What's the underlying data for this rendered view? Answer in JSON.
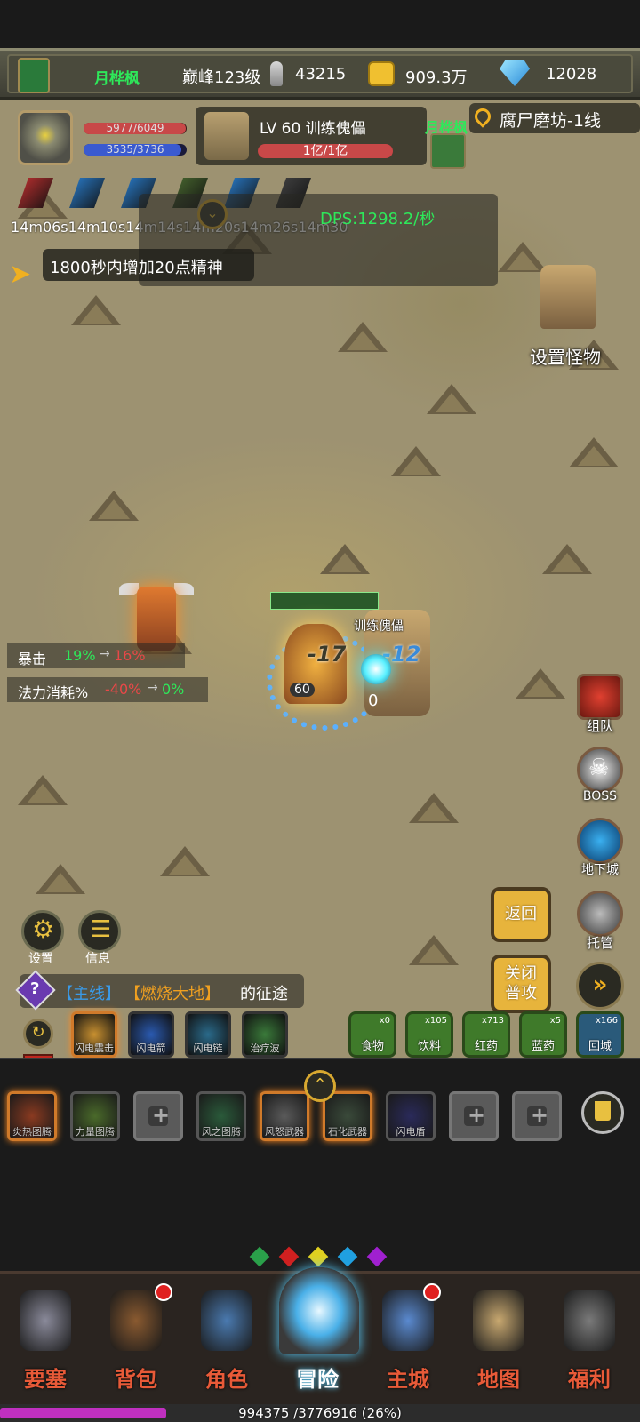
{
  "topbar": {
    "player_name": "月桦枫",
    "peak_level": "巅峰123级",
    "power": "43215",
    "gold": "909.3万",
    "diamonds": "12028"
  },
  "location": "腐尸磨坊-1线",
  "player": {
    "hp_text": "5977/6049",
    "hp_fraction": 0.988,
    "mp_text": "3535/3736",
    "mp_fraction": 0.946
  },
  "target": {
    "title": "LV 60 训练傀儡",
    "hp_text": "1亿/1亿",
    "hp_fraction": 1.0
  },
  "teammate_name": "月桦枫",
  "buffs": {
    "timers": "14m06s14m10s14m14s14m20s14m26s14m30s",
    "colors": [
      "#c23030",
      "#2a7fd0",
      "#2a7fd0",
      "#4a6a30",
      "#2a7fd0",
      "#444444"
    ]
  },
  "dps": "DPS:1298.2/秒",
  "notice": "1800秒内增加20点精神",
  "set_monster": "设置怪物",
  "stats": {
    "crit_label": "暴击",
    "crit_from": "19%",
    "crit_to": "16%",
    "mana_label": "法力消耗%",
    "mana_from": "-40%",
    "mana_to": "0%"
  },
  "battle": {
    "dummy_label": "训练傀儡",
    "damage1": "-17",
    "damage2": "-12",
    "level_badge": "60",
    "zero": "0"
  },
  "side_buttons": {
    "team": "组队",
    "boss": "BOSS",
    "dungeon": "地下城",
    "auto": "托管"
  },
  "action_buttons": {
    "back": "返回",
    "close_attack": "关闭\n普攻"
  },
  "menu": {
    "settings": "设置",
    "info": "信息"
  },
  "quest": {
    "prefix": "【主线】",
    "highlight": "【燃烧大地】",
    "suffix": "的征途"
  },
  "skills": [
    {
      "label": "闪电震击"
    },
    {
      "label": "闪电箭"
    },
    {
      "label": "闪电链"
    },
    {
      "label": "治疗波"
    }
  ],
  "potions": [
    {
      "label": "食物",
      "count": "x0"
    },
    {
      "label": "饮料",
      "count": "x105"
    },
    {
      "label": "红药",
      "count": "x713"
    },
    {
      "label": "蓝药",
      "count": "x5"
    },
    {
      "label": "回城",
      "count": "x166"
    }
  ],
  "gear_slots": [
    {
      "label": "炎热图腾"
    },
    {
      "label": "力量图腾"
    },
    {
      "label": ""
    },
    {
      "label": "风之图腾"
    },
    {
      "label": "风怒武器"
    },
    {
      "label": "石化武器"
    },
    {
      "label": "闪电盾"
    },
    {
      "label": ""
    },
    {
      "label": ""
    }
  ],
  "nav": [
    {
      "label": "要塞"
    },
    {
      "label": "背包"
    },
    {
      "label": "角色"
    },
    {
      "label": "冒险"
    },
    {
      "label": "主城"
    },
    {
      "label": "地图"
    },
    {
      "label": "福利"
    }
  ],
  "xp": {
    "text": "994375 /3776916 (26%)",
    "fraction": 0.26
  },
  "page_dots": [
    "#2aa04a",
    "#d02020",
    "#e0d020",
    "#20a0e0",
    "#a020d0"
  ]
}
